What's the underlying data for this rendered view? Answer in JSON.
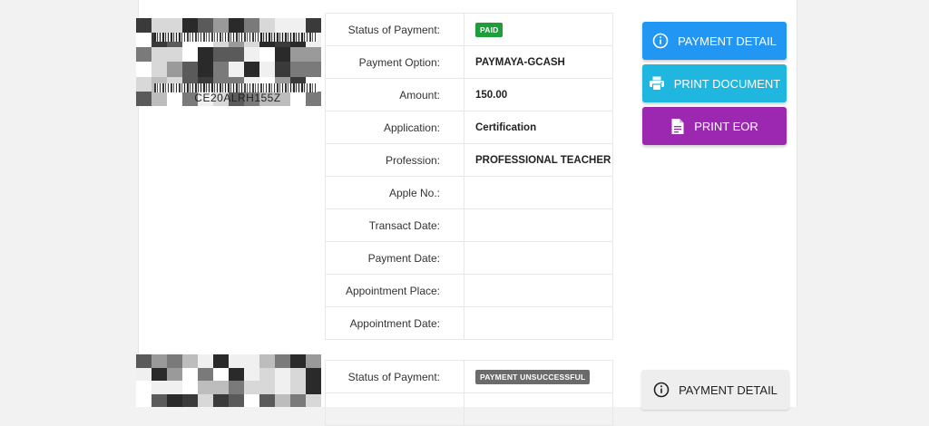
{
  "records": [
    {
      "barcode_text": "CE20ALRH155Z",
      "rows": [
        {
          "label": "Status of Payment:",
          "value": "PAID",
          "badge": true,
          "badge_color": "#1e9e3a"
        },
        {
          "label": "Payment Option:",
          "value": "PAYMAYA-GCASH"
        },
        {
          "label": "Amount:",
          "value": "150.00"
        },
        {
          "label": "Application:",
          "value": "Certification"
        },
        {
          "label": "Profession:",
          "value": "PROFESSIONAL TEACHER"
        },
        {
          "label": "Apple No.:",
          "value": ""
        },
        {
          "label": "Transact Date:",
          "value": ""
        },
        {
          "label": "Payment Date:",
          "value": ""
        },
        {
          "label": "Appointment Place:",
          "value": ""
        },
        {
          "label": "Appointment Date:",
          "value": ""
        }
      ],
      "buttons": {
        "payment_detail": {
          "label": "PAYMENT DETAIL",
          "icon": "info-icon",
          "color": "#2196f3"
        },
        "print_document": {
          "label": "PRINT DOCUMENT",
          "icon": "printer-icon",
          "color": "#1fb6e0"
        },
        "print_eor": {
          "label": "PRINT EOR",
          "icon": "document-icon",
          "color": "#9c27b0"
        }
      }
    },
    {
      "rows": [
        {
          "label": "Status of Payment:",
          "value": "PAYMENT UNSUCCESSFUL",
          "badge": true,
          "badge_color": "#6b6b6b"
        }
      ],
      "buttons": {
        "payment_detail": {
          "label": "PAYMENT DETAIL",
          "icon": "info-icon",
          "color": "#eeeeee"
        }
      }
    }
  ]
}
